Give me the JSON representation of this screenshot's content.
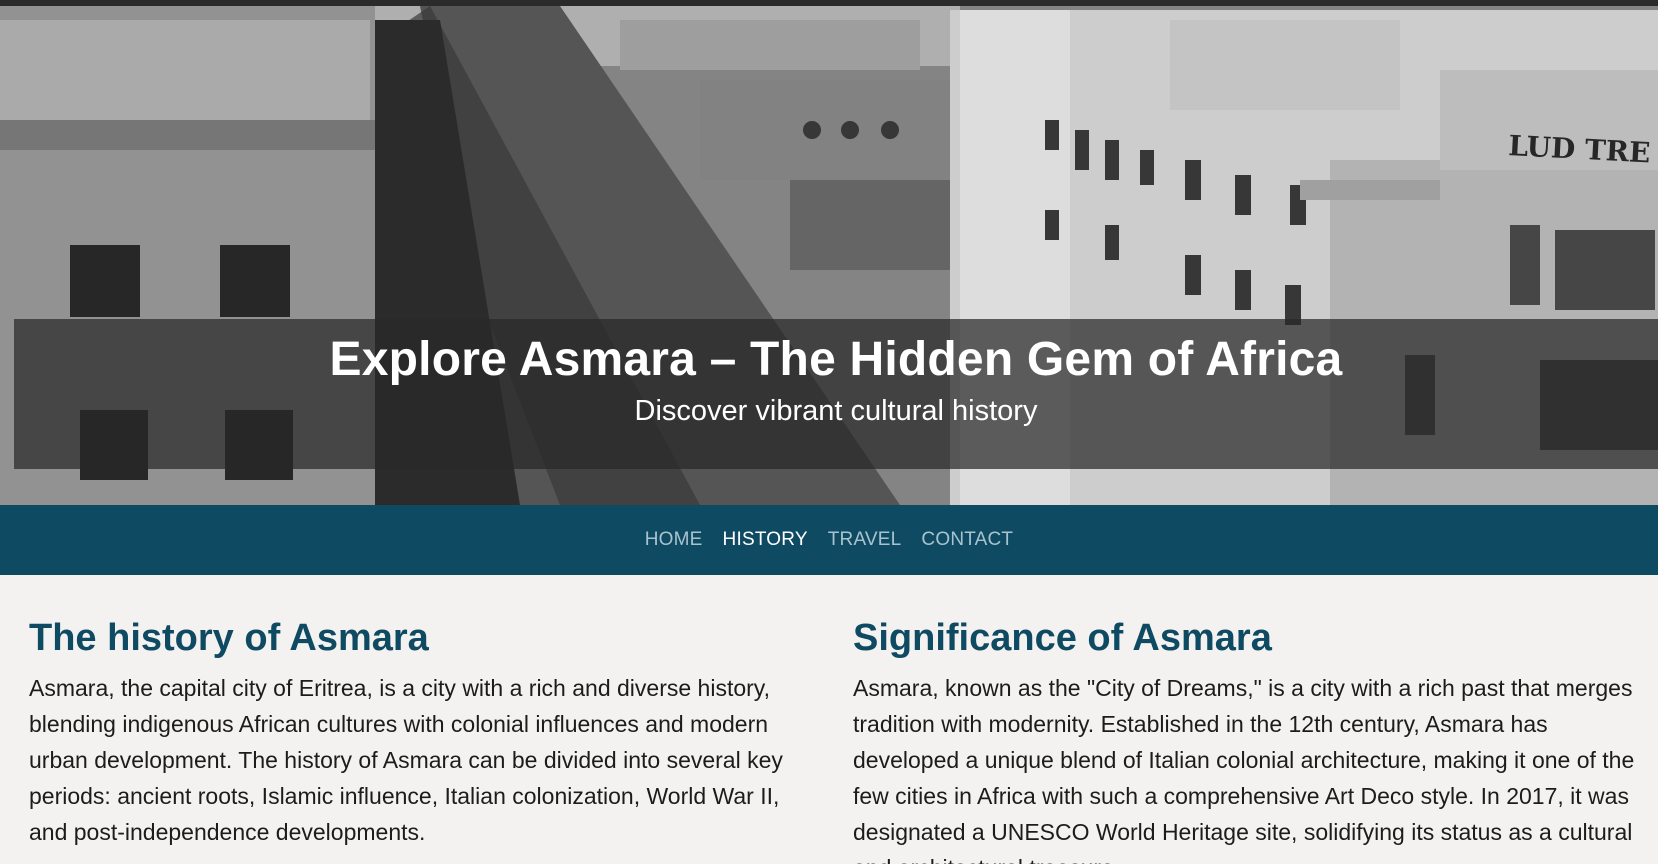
{
  "hero": {
    "title": "Explore Asmara – The Hidden Gem of Africa",
    "subtitle": "Discover vibrant cultural history",
    "image_sign_text": "LUD TRE"
  },
  "nav": {
    "items": [
      {
        "label": "HOME",
        "active": false
      },
      {
        "label": "HISTORY",
        "active": true
      },
      {
        "label": "TRAVEL",
        "active": false
      },
      {
        "label": "CONTACT",
        "active": false
      }
    ]
  },
  "sections": [
    {
      "heading": "The history of Asmara",
      "body": "Asmara, the capital city of Eritrea, is a city with a rich and diverse history, blending indigenous African cultures with colonial influences and modern urban development. The history of Asmara can be divided into several key periods: ancient roots, Islamic influence, Italian colonization, World War II, and post-independence developments."
    },
    {
      "heading": "Significance of Asmara",
      "body": "Asmara, known as the \"City of Dreams,\" is a city with a rich past that merges tradition with modernity. Established in the 12th century, Asmara has developed a unique blend of Italian colonial architecture, making it one of the few cities in Africa with such a comprehensive Art Deco style. In 2017, it was designated a UNESCO World Heritage site, solidifying its status as a cultural and architectural treasure."
    }
  ],
  "colors": {
    "nav_background": "#0f4a63",
    "heading": "#0f4a63",
    "nav_link": "#a8c3cf",
    "nav_link_active": "#ffffff",
    "page_background": "#f4f2f0"
  }
}
